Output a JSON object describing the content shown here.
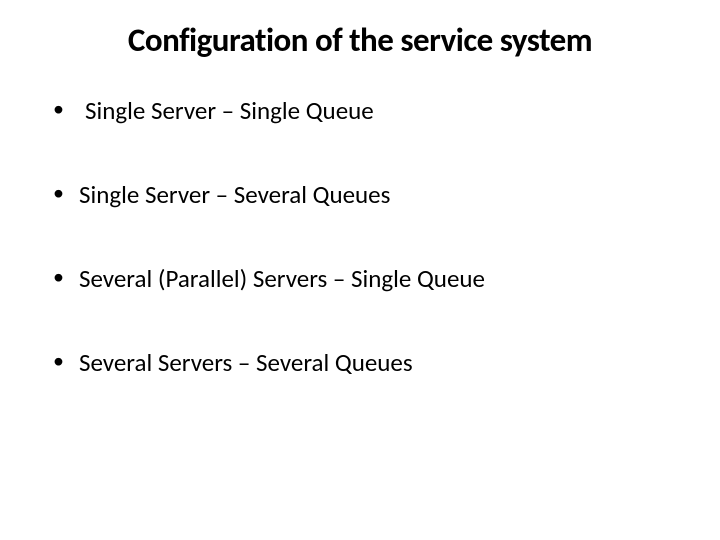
{
  "slide": {
    "title": "Configuration of the service system",
    "bullets": [
      " Single Server – Single Queue",
      "Single Server – Several Queues",
      "Several (Parallel) Servers – Single Queue",
      "Several Servers – Several Queues"
    ]
  }
}
